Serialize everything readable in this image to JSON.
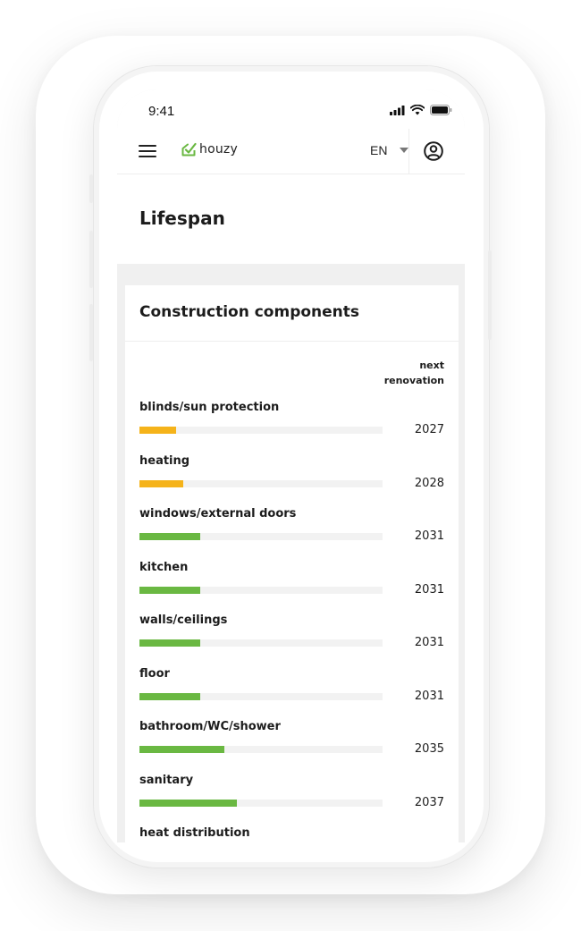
{
  "status_bar": {
    "time": "9:41"
  },
  "header": {
    "menu_icon": "hamburger-icon",
    "logo_text": "houzy",
    "logo_color": "#6ab842",
    "language": "EN",
    "profile_icon": "user-circle-icon"
  },
  "page": {
    "title": "Lifespan"
  },
  "card": {
    "title": "Construction components",
    "column_header_line1": "next",
    "column_header_line2": "renovation"
  },
  "colors": {
    "warning": "#f5b31a",
    "ok": "#6ab842",
    "track": "#f2f2f2"
  },
  "components": [
    {
      "label": "blinds/sun protection",
      "year": "2027",
      "progress": 0.15,
      "status": "warning"
    },
    {
      "label": "heating",
      "year": "2028",
      "progress": 0.18,
      "status": "warning"
    },
    {
      "label": "windows/external doors",
      "year": "2031",
      "progress": 0.25,
      "status": "ok"
    },
    {
      "label": "kitchen",
      "year": "2031",
      "progress": 0.25,
      "status": "ok"
    },
    {
      "label": "walls/ceilings",
      "year": "2031",
      "progress": 0.25,
      "status": "ok"
    },
    {
      "label": "floor",
      "year": "2031",
      "progress": 0.25,
      "status": "ok"
    },
    {
      "label": "bathroom/WC/shower",
      "year": "2035",
      "progress": 0.35,
      "status": "ok"
    },
    {
      "label": "sanitary",
      "year": "2037",
      "progress": 0.4,
      "status": "ok"
    },
    {
      "label": "heat distribution",
      "year": "",
      "progress": null,
      "status": "ok"
    }
  ]
}
